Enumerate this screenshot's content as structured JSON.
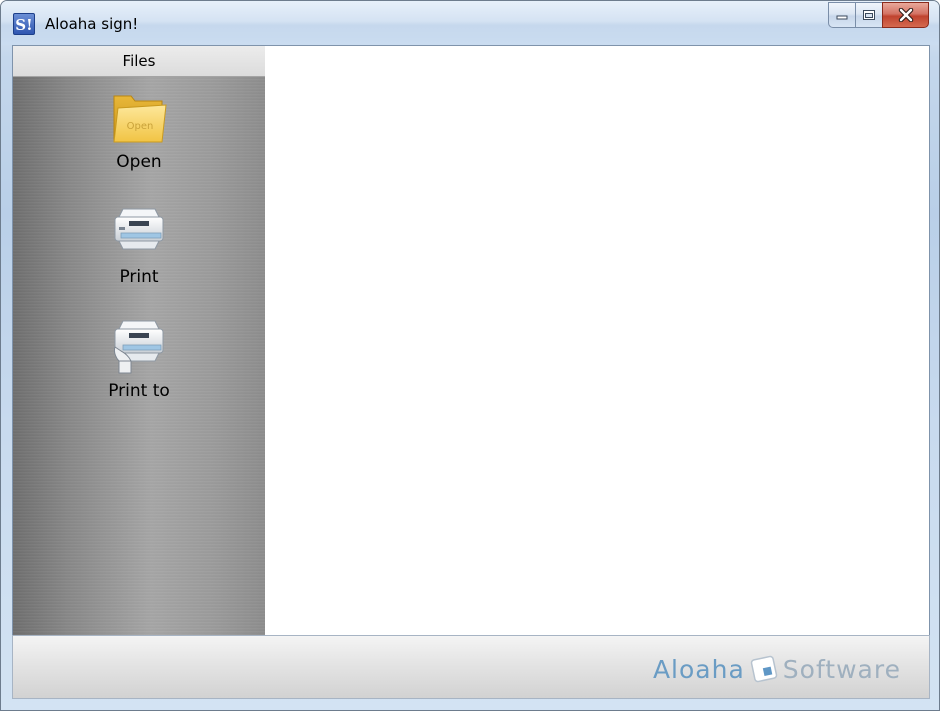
{
  "window": {
    "title": "Aloaha sign!",
    "icon_letter": "S!"
  },
  "caption_buttons": [
    "minimize-icon",
    "maximize-icon",
    "close-icon"
  ],
  "sidebar": {
    "header": "Files",
    "items": [
      {
        "label": "Open",
        "icon": "folder-icon",
        "icon_text": "Open"
      },
      {
        "label": "Print",
        "icon": "printer-icon"
      },
      {
        "label": "Print to",
        "icon": "printer-to-icon"
      }
    ]
  },
  "footer": {
    "brand_left": "Aloaha",
    "brand_right": "Software"
  },
  "colors": {
    "brand_blue": "#6a9cc4",
    "brand_gray": "#9fb0bf",
    "folder_yellow": "#f4cf56",
    "close_red": "#c0432f"
  }
}
